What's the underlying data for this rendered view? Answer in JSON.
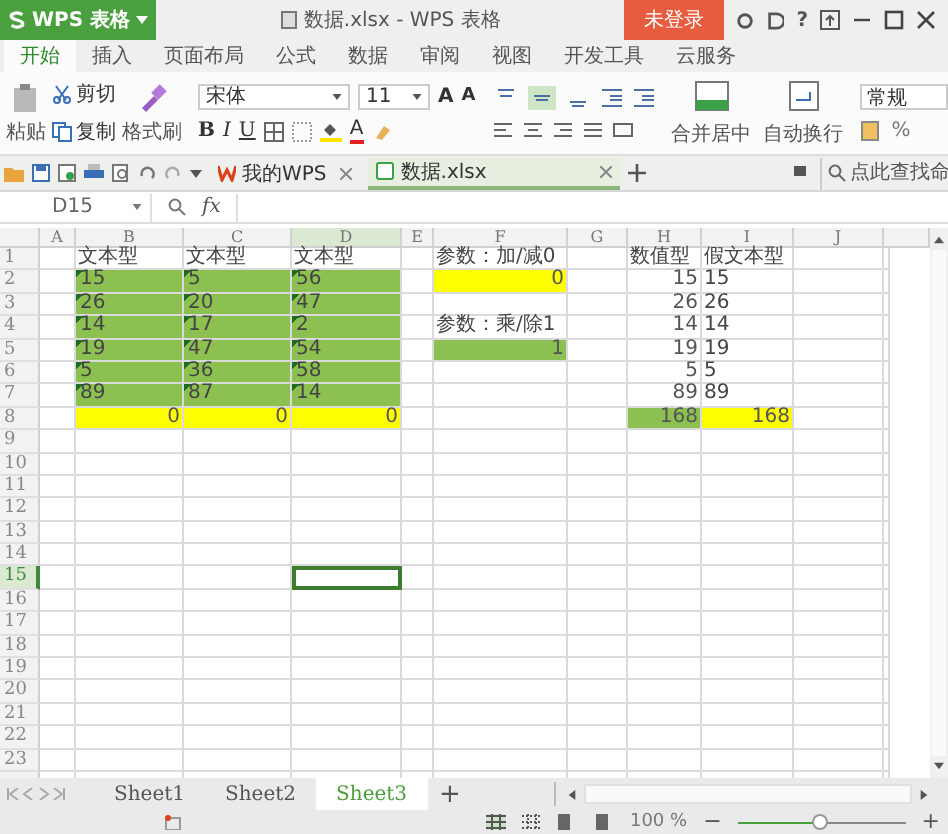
{
  "app": {
    "name": "WPS 表格",
    "title": "数据.xlsx - WPS 表格",
    "login": "未登录",
    "help": "?"
  },
  "menu_tabs": [
    {
      "label": "开始",
      "selected": true
    },
    {
      "label": "插入",
      "selected": false
    },
    {
      "label": "页面布局",
      "selected": false
    },
    {
      "label": "公式",
      "selected": false
    },
    {
      "label": "数据",
      "selected": false
    },
    {
      "label": "审阅",
      "selected": false
    },
    {
      "label": "视图",
      "selected": false
    },
    {
      "label": "开发工具",
      "selected": false
    },
    {
      "label": "云服务",
      "selected": false
    }
  ],
  "ribbon": {
    "paste": "粘贴",
    "cut": "剪切",
    "copy": "复制",
    "format_painter": "格式刷",
    "font": "宋体",
    "font_size": "11",
    "font_buttons": [
      {
        "label": "A",
        "kind": "grow"
      },
      {
        "label": "A",
        "kind": "shrink"
      }
    ],
    "style_buttons": [
      {
        "label": "B",
        "kind": "bold"
      },
      {
        "label": "I",
        "kind": "italic"
      },
      {
        "label": "U",
        "kind": "underline"
      }
    ],
    "font_color": "A",
    "align_buttons": [
      {
        "kind": "top",
        "selected": false
      },
      {
        "kind": "middle",
        "selected": true
      },
      {
        "kind": "bottom",
        "selected": false
      }
    ],
    "merge": "合并居中",
    "wrap": "自动换行",
    "number_format": "常规",
    "percent": "%"
  },
  "doc_tabs": [
    {
      "label": "我的WPS",
      "selected": false
    },
    {
      "label": "数据.xlsx",
      "selected": true
    }
  ],
  "command_search": {
    "placeholder": "点此查找命"
  },
  "formula_bar": {
    "name_box": "D15",
    "fx": "fx"
  },
  "grid": {
    "columns": [
      {
        "label": "A",
        "selected": false
      },
      {
        "label": "B",
        "selected": false
      },
      {
        "label": "C",
        "selected": false
      },
      {
        "label": "D",
        "selected": true
      },
      {
        "label": "E",
        "selected": false
      },
      {
        "label": "F",
        "selected": false
      },
      {
        "label": "G",
        "selected": false
      },
      {
        "label": "H",
        "selected": false
      },
      {
        "label": "I",
        "selected": false
      },
      {
        "label": "J",
        "selected": false
      }
    ],
    "rows": [
      {
        "label": "1",
        "selected": false,
        "cells": [
          {
            "kind": "empty"
          },
          {
            "kind": "text",
            "text": "文本型"
          },
          {
            "kind": "text",
            "text": "文本型"
          },
          {
            "kind": "text",
            "text": "文本型"
          },
          {
            "kind": "empty"
          },
          {
            "kind": "text",
            "text": "参数：加/减0"
          },
          {
            "kind": "empty"
          },
          {
            "kind": "text",
            "text": "数值型"
          },
          {
            "kind": "text",
            "text": "假文本型"
          },
          {
            "kind": "empty"
          }
        ]
      },
      {
        "label": "2",
        "selected": false,
        "cells": [
          {
            "kind": "empty"
          },
          {
            "kind": "text-number",
            "text": "15",
            "color": "#8cc152"
          },
          {
            "kind": "text-number",
            "text": "5",
            "color": "#8cc152"
          },
          {
            "kind": "text-number",
            "text": "56",
            "color": "#8cc152"
          },
          {
            "kind": "empty"
          },
          {
            "kind": "number",
            "text": "0",
            "color": "#ffff00"
          },
          {
            "kind": "empty"
          },
          {
            "kind": "number",
            "text": "15"
          },
          {
            "kind": "text",
            "text": "15"
          },
          {
            "kind": "empty"
          }
        ]
      },
      {
        "label": "3",
        "selected": false,
        "cells": [
          {
            "kind": "empty"
          },
          {
            "kind": "text-number",
            "text": "26",
            "color": "#8cc152"
          },
          {
            "kind": "text-number",
            "text": "20",
            "color": "#8cc152"
          },
          {
            "kind": "text-number",
            "text": "47",
            "color": "#8cc152"
          },
          {
            "kind": "empty"
          },
          {
            "kind": "empty"
          },
          {
            "kind": "empty"
          },
          {
            "kind": "number",
            "text": "26"
          },
          {
            "kind": "text",
            "text": "26"
          },
          {
            "kind": "empty"
          }
        ]
      },
      {
        "label": "4",
        "selected": false,
        "cells": [
          {
            "kind": "empty"
          },
          {
            "kind": "text-number",
            "text": "14",
            "color": "#8cc152"
          },
          {
            "kind": "text-number",
            "text": "17",
            "color": "#8cc152"
          },
          {
            "kind": "text-number",
            "text": "2",
            "color": "#8cc152"
          },
          {
            "kind": "empty"
          },
          {
            "kind": "text",
            "text": "参数：乘/除1"
          },
          {
            "kind": "empty"
          },
          {
            "kind": "number",
            "text": "14"
          },
          {
            "kind": "text",
            "text": "14"
          },
          {
            "kind": "empty"
          }
        ]
      },
      {
        "label": "5",
        "selected": false,
        "cells": [
          {
            "kind": "empty"
          },
          {
            "kind": "text-number",
            "text": "19",
            "color": "#8cc152"
          },
          {
            "kind": "text-number",
            "text": "47",
            "color": "#8cc152"
          },
          {
            "kind": "text-number",
            "text": "54",
            "color": "#8cc152"
          },
          {
            "kind": "empty"
          },
          {
            "kind": "number",
            "text": "1",
            "color": "#8cc152"
          },
          {
            "kind": "empty"
          },
          {
            "kind": "number",
            "text": "19"
          },
          {
            "kind": "text",
            "text": "19"
          },
          {
            "kind": "empty"
          }
        ]
      },
      {
        "label": "6",
        "selected": false,
        "cells": [
          {
            "kind": "empty"
          },
          {
            "kind": "text-number",
            "text": "5",
            "color": "#8cc152"
          },
          {
            "kind": "text-number",
            "text": "36",
            "color": "#8cc152"
          },
          {
            "kind": "text-number",
            "text": "58",
            "color": "#8cc152"
          },
          {
            "kind": "empty"
          },
          {
            "kind": "empty"
          },
          {
            "kind": "empty"
          },
          {
            "kind": "number",
            "text": "5"
          },
          {
            "kind": "text",
            "text": "5"
          },
          {
            "kind": "empty"
          }
        ]
      },
      {
        "label": "7",
        "selected": false,
        "cells": [
          {
            "kind": "empty"
          },
          {
            "kind": "text-number",
            "text": "89",
            "color": "#8cc152"
          },
          {
            "kind": "text-number",
            "text": "87",
            "color": "#8cc152"
          },
          {
            "kind": "text-number",
            "text": "14",
            "color": "#8cc152"
          },
          {
            "kind": "empty"
          },
          {
            "kind": "empty"
          },
          {
            "kind": "empty"
          },
          {
            "kind": "number",
            "text": "89"
          },
          {
            "kind": "text",
            "text": "89"
          },
          {
            "kind": "empty"
          }
        ]
      },
      {
        "label": "8",
        "selected": false,
        "cells": [
          {
            "kind": "empty"
          },
          {
            "kind": "number",
            "text": "0",
            "color": "#ffff00"
          },
          {
            "kind": "number",
            "text": "0",
            "color": "#ffff00"
          },
          {
            "kind": "number",
            "text": "0",
            "color": "#ffff00"
          },
          {
            "kind": "empty"
          },
          {
            "kind": "empty"
          },
          {
            "kind": "empty"
          },
          {
            "kind": "number",
            "text": "168",
            "color": "#8cc152"
          },
          {
            "kind": "number",
            "text": "168",
            "color": "#ffff00"
          },
          {
            "kind": "empty"
          }
        ]
      },
      {
        "label": "9",
        "selected": false
      },
      {
        "label": "10",
        "selected": false
      },
      {
        "label": "11",
        "selected": false
      },
      {
        "label": "12",
        "selected": false
      },
      {
        "label": "13",
        "selected": false
      },
      {
        "label": "14",
        "selected": false
      },
      {
        "label": "15",
        "selected": true
      },
      {
        "label": "16",
        "selected": false
      },
      {
        "label": "17",
        "selected": false
      },
      {
        "label": "18",
        "selected": false
      },
      {
        "label": "19",
        "selected": false
      },
      {
        "label": "20",
        "selected": false
      },
      {
        "label": "21",
        "selected": false
      },
      {
        "label": "22",
        "selected": false
      },
      {
        "label": "23",
        "selected": false
      }
    ]
  },
  "sheet_tabs": [
    {
      "label": "Sheet1",
      "selected": false
    },
    {
      "label": "Sheet2",
      "selected": false
    },
    {
      "label": "Sheet3",
      "selected": true
    }
  ],
  "add_sheet": "+",
  "status_bar": {
    "zoom": "100 %",
    "zoom_minus": "−",
    "zoom_plus": "+",
    "level": 0.49
  }
}
